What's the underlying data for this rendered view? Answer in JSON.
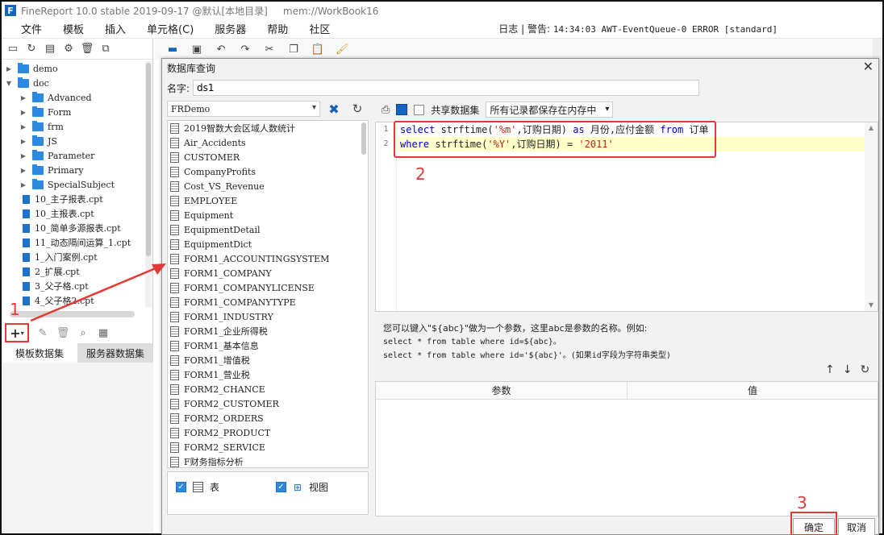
{
  "window": {
    "title": "FineReport 10.0 stable 2019-09-17 @默认[本地目录]     mem://WorkBook16"
  },
  "menubar": {
    "items": [
      "文件",
      "模板",
      "插入",
      "单元格(C)",
      "服务器",
      "帮助",
      "社区"
    ],
    "status_log": "日志 | 警告:",
    "status_detail": "14:34:03 AWT-EventQueue-0 ERROR [standard]"
  },
  "left_panel": {
    "tree": [
      {
        "label": "demo",
        "type": "folder",
        "expanded": false,
        "indent": 0
      },
      {
        "label": "doc",
        "type": "folder",
        "expanded": true,
        "indent": 0
      },
      {
        "label": "Advanced",
        "type": "folder",
        "expanded": false,
        "indent": 1
      },
      {
        "label": "Form",
        "type": "folder",
        "expanded": false,
        "indent": 1
      },
      {
        "label": "frm",
        "type": "folder",
        "expanded": false,
        "indent": 1
      },
      {
        "label": "JS",
        "type": "folder",
        "expanded": false,
        "indent": 1
      },
      {
        "label": "Parameter",
        "type": "folder",
        "expanded": false,
        "indent": 1
      },
      {
        "label": "Primary",
        "type": "folder",
        "expanded": false,
        "indent": 1
      },
      {
        "label": "SpecialSubject",
        "type": "folder",
        "expanded": false,
        "indent": 1
      },
      {
        "label": "10_主子报表.cpt",
        "type": "file",
        "indent": 1
      },
      {
        "label": "10_主报表.cpt",
        "type": "file",
        "indent": 1
      },
      {
        "label": "10_简单多源报表.cpt",
        "type": "file",
        "indent": 1
      },
      {
        "label": "11_动态隔间运算_1.cpt",
        "type": "file",
        "indent": 1
      },
      {
        "label": "1_入门案例.cpt",
        "type": "file",
        "indent": 1
      },
      {
        "label": "2_扩展.cpt",
        "type": "file",
        "indent": 1
      },
      {
        "label": "3_父子格.cpt",
        "type": "file",
        "indent": 1
      },
      {
        "label": "4_父子格2.cpt",
        "type": "file",
        "indent": 1
      }
    ],
    "add_button_label": "+",
    "tabs": [
      "模板数据集",
      "服务器数据集"
    ]
  },
  "dialog": {
    "title": "数据库查询",
    "name_label": "名字:",
    "name_value": "ds1",
    "db_connection": "FRDemo",
    "tables": [
      "2019智数大会区域人数统计",
      "Air_Accidents",
      "CUSTOMER",
      "CompanyProfits",
      "Cost_VS_Revenue",
      "EMPLOYEE",
      "Equipment",
      "EquipmentDetail",
      "EquipmentDict",
      "FORM1_ACCOUNTINGSYSTEM",
      "FORM1_COMPANY",
      "FORM1_COMPANYLICENSE",
      "FORM1_COMPANYTYPE",
      "FORM1_INDUSTRY",
      "FORM1_企业所得税",
      "FORM1_基本信息",
      "FORM1_增值税",
      "FORM1_营业税",
      "FORM2_CHANCE",
      "FORM2_CUSTOMER",
      "FORM2_ORDERS",
      "FORM2_PRODUCT",
      "FORM2_SERVICE",
      "F财务指标分析"
    ],
    "filter_table_label": "表",
    "filter_view_label": "视图",
    "share_dataset_label": "共享数据集",
    "memory_option": "所有记录都保存在内存中",
    "sql": {
      "line_numbers": [
        "1",
        "2"
      ],
      "line1": {
        "kw1": "select",
        "fn1": " strftime(",
        "str1": "'%m'",
        "rest1": ",订购日期) ",
        "kw2": "as",
        "rest2": " 月份,应付金额 ",
        "kw3": "from",
        "rest3": " 订单"
      },
      "line2": {
        "kw1": "where",
        "fn1": " strftime(",
        "str1": "'%Y'",
        "rest1": ",订购日期) = ",
        "str2": "'2011'"
      }
    },
    "param_hint_line1": "您可以键入\"${abc}\"做为一个参数，这里abc是参数的名称。例如:",
    "param_hint_line2": "select * from table where id=${abc}。",
    "param_hint_line3": "select * from table where id='${abc}'。(如果id字段为字符串类型)",
    "param_columns": [
      "参数",
      "值"
    ],
    "ok_label": "确定",
    "cancel_label": "取消"
  },
  "annotations": {
    "step1": "1",
    "step2": "2",
    "step3": "3",
    "color": "#e53935"
  }
}
